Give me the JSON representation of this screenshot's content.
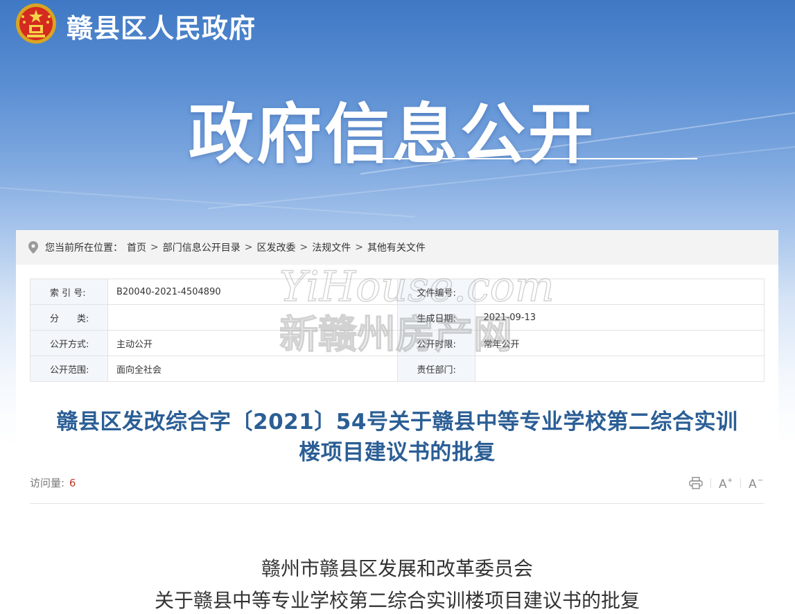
{
  "header": {
    "site_title": "赣县区人民政府",
    "banner_title": "政府信息公开"
  },
  "breadcrumb": {
    "prefix": "您当前所在位置：",
    "items": [
      "首页",
      "部门信息公开目录",
      "区发改委",
      "法规文件",
      "其他有关文件"
    ],
    "separator": ">"
  },
  "meta_table": {
    "rows": [
      {
        "k1": "索 引 号:",
        "v1": "B20040-2021-4504890",
        "k2": "文件编号:",
        "v2": ""
      },
      {
        "k1": "分　　类:",
        "v1": "",
        "k2": "生成日期:",
        "v2": "2021-09-13"
      },
      {
        "k1": "公开方式:",
        "v1": "主动公开",
        "k2": "公开时限:",
        "v2": "常年公开"
      },
      {
        "k1": "公开范围:",
        "v1": "面向全社会",
        "k2": "责任部门:",
        "v2": ""
      }
    ]
  },
  "watermark": {
    "script_text": "YiHouse.com",
    "chinese_text": "新赣州房产网"
  },
  "document": {
    "title_line1": "赣县区发改综合字〔2021〕54号关于赣县中等专业学校第二综合实训",
    "title_line2": "楼项目建议书的批复",
    "visits_label": "访问量:",
    "visits_count": "6",
    "body_line1": "赣州市赣县区发展和改革委员会",
    "body_line2": "关于赣县中等专业学校第二综合实训楼项目建议书的批复"
  },
  "tools": {
    "print_icon": "print-icon",
    "font_increase": "A+",
    "font_decrease": "A-"
  },
  "colors": {
    "hero_top": "#3f78c4",
    "title_blue": "#2b5e95",
    "visits_count": "#c0392b"
  }
}
